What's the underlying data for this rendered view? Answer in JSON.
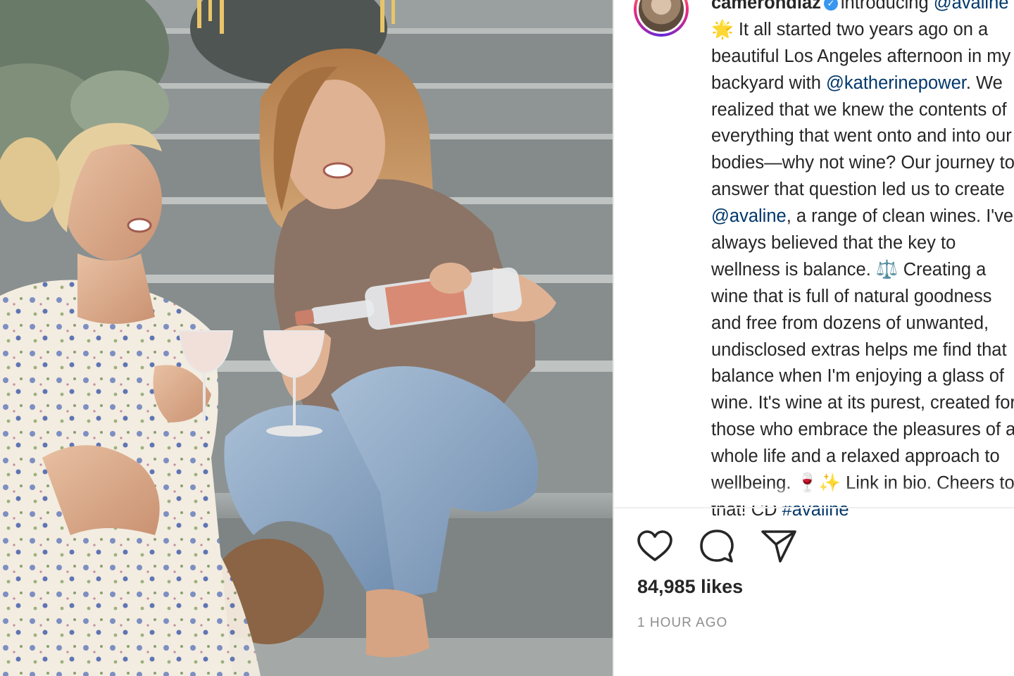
{
  "post": {
    "username": "camerondiaz",
    "caption_lines": [
      {
        "prefix": "introducing ",
        "mention": "@avaline",
        "suffix": ""
      },
      {
        "prefix": "🌟 It all started two years ago on a",
        "mention": "",
        "suffix": ""
      },
      {
        "prefix": "beautiful Los Angeles afternoon in my",
        "mention": "",
        "suffix": ""
      },
      {
        "prefix": "backyard with ",
        "mention": "@katherinepower",
        "suffix": ". We"
      },
      {
        "prefix": "realized that we knew the contents of",
        "mention": "",
        "suffix": ""
      },
      {
        "prefix": "everything that went onto and into our",
        "mention": "",
        "suffix": ""
      },
      {
        "prefix": "bodies—why not wine? Our journey to",
        "mention": "",
        "suffix": ""
      },
      {
        "prefix": "answer that question led us to create",
        "mention": "",
        "suffix": ""
      },
      {
        "prefix": "",
        "mention": "@avaline",
        "suffix": ", a range of clean wines. I've"
      },
      {
        "prefix": "always believed that the key to",
        "mention": "",
        "suffix": ""
      },
      {
        "prefix": "wellness is balance. ⚖️ Creating a",
        "mention": "",
        "suffix": ""
      },
      {
        "prefix": "wine that is full of natural goodness",
        "mention": "",
        "suffix": ""
      },
      {
        "prefix": "and free from dozens of unwanted,",
        "mention": "",
        "suffix": ""
      },
      {
        "prefix": "undisclosed extras helps me find that",
        "mention": "",
        "suffix": ""
      },
      {
        "prefix": "balance when I'm enjoying a glass of",
        "mention": "",
        "suffix": ""
      },
      {
        "prefix": "wine. It's wine at its purest, created for",
        "mention": "",
        "suffix": ""
      },
      {
        "prefix": "those who embrace the pleasures of a",
        "mention": "",
        "suffix": ""
      },
      {
        "prefix": "whole life and a relaxed approach to",
        "mention": "",
        "suffix": ""
      },
      {
        "prefix": "wellbeing. 🍷✨ Link in bio. Cheers to",
        "mention": "",
        "suffix": ""
      },
      {
        "prefix": "that! CD ",
        "mention": "#avaline",
        "suffix": ""
      }
    ],
    "likes": "84,985 likes",
    "time": "1 HOUR AGO"
  },
  "icons": {
    "like": "heart-icon",
    "comment": "comment-icon",
    "share": "send-icon"
  },
  "colors": {
    "mention": "#00376b",
    "text": "#262626",
    "muted": "#8e8e8e",
    "verified": "#3897f0"
  }
}
